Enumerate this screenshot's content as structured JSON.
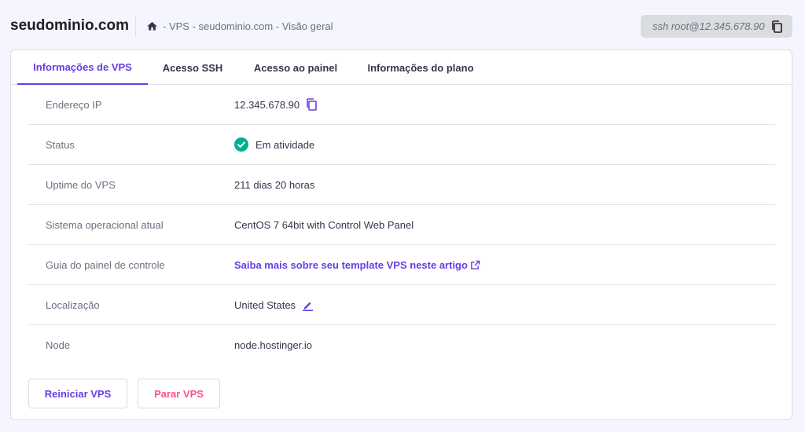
{
  "header": {
    "domain": "seudominio.com",
    "breadcrumb": "- VPS - seudominio.com - Visão geral",
    "ssh_command": "ssh root@12.345.678.90"
  },
  "tabs": [
    {
      "label": "Informações de VPS",
      "active": true
    },
    {
      "label": "Acesso SSH",
      "active": false
    },
    {
      "label": "Acesso ao painel",
      "active": false
    },
    {
      "label": "Informações do plano",
      "active": false
    }
  ],
  "info": {
    "ip": {
      "label": "Endereço IP",
      "value": "12.345.678.90"
    },
    "status": {
      "label": "Status",
      "value": "Em atividade"
    },
    "uptime": {
      "label": "Uptime do VPS",
      "value": "211 dias 20 horas"
    },
    "os": {
      "label": "Sistema operacional atual",
      "value": "CentOS 7 64bit with Control Web Panel"
    },
    "guide": {
      "label": "Guia do painel de controle",
      "value": "Saiba mais sobre seu template VPS neste artigo"
    },
    "location": {
      "label": "Localização",
      "value": "United States"
    },
    "node": {
      "label": "Node",
      "value": "node.hostinger.io"
    }
  },
  "actions": {
    "restart": "Reiniciar VPS",
    "stop": "Parar VPS"
  },
  "colors": {
    "accent": "#673de6",
    "danger": "#fc5185",
    "success": "#00b090"
  }
}
